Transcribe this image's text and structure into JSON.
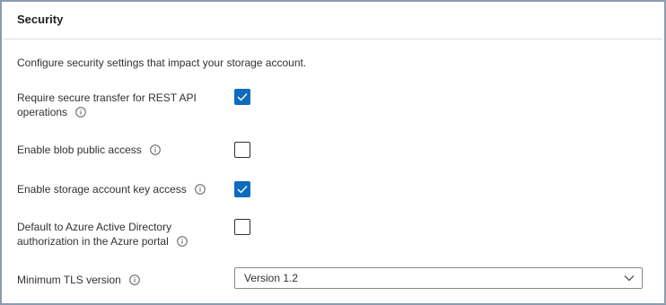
{
  "section": {
    "title": "Security",
    "description": "Configure security settings that impact your storage account."
  },
  "settings": [
    {
      "label_line1": "Require secure transfer for REST API",
      "label_line2": "operations",
      "checked": true,
      "has_info": true
    },
    {
      "label_line1": "Enable blob public access",
      "label_line2": "",
      "checked": false,
      "has_info": true
    },
    {
      "label_line1": "Enable storage account key access",
      "label_line2": "",
      "checked": true,
      "has_info": true
    },
    {
      "label_line1": "Default to Azure Active Directory",
      "label_line2": "authorization in the Azure portal",
      "checked": false,
      "has_info": true
    }
  ],
  "tls": {
    "label": "Minimum TLS version",
    "selected": "Version 1.2"
  },
  "colors": {
    "accent": "#0f6cbd",
    "border": "#8a9bb0"
  },
  "icons": {
    "info": "info-icon",
    "check": "checkmark-icon",
    "dropdown": "chevron-down-icon"
  }
}
